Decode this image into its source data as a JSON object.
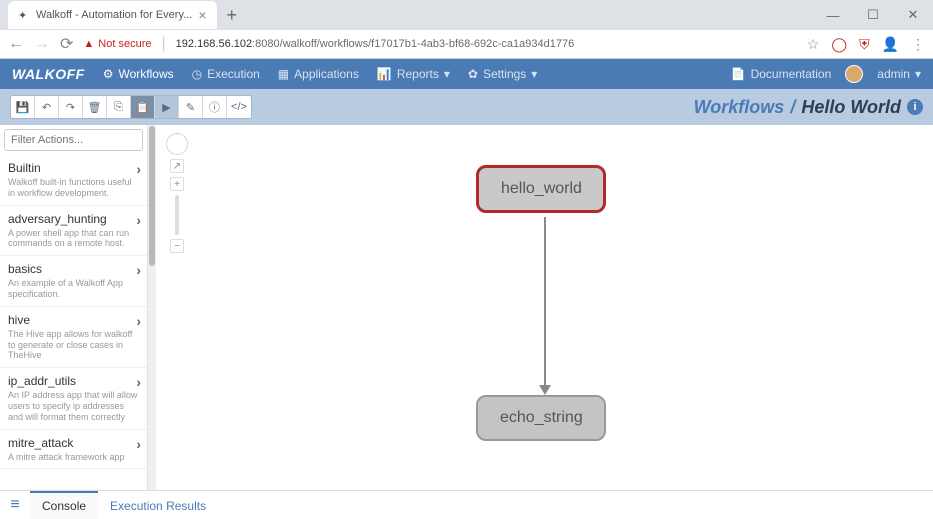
{
  "browser": {
    "tab_title": "Walkoff - Automation for Every...",
    "not_secure": "Not secure",
    "url_host": "192.168.56.102",
    "url_port": ":8080",
    "url_path": "/walkoff/workflows/f17017b1-4ab3-bf68-692c-ca1a934d1776"
  },
  "header": {
    "logo": "WALKOFF",
    "nav": {
      "workflows": "Workflows",
      "execution": "Execution",
      "applications": "Applications",
      "reports": "Reports",
      "settings": "Settings"
    },
    "docs": "Documentation",
    "user": "admin"
  },
  "breadcrumb": {
    "root": "Workflows",
    "sep": "/",
    "current": "Hello World"
  },
  "filter_placeholder": "Filter Actions...",
  "actions": [
    {
      "name": "Builtin",
      "desc": "Walkoff built-in functions useful in workflow development."
    },
    {
      "name": "adversary_hunting",
      "desc": "A power shell app that can run commands on a remote host."
    },
    {
      "name": "basics",
      "desc": "An example of a Walkoff App specification."
    },
    {
      "name": "hive",
      "desc": "The Hive app allows for walkoff to generate or close cases in TheHive"
    },
    {
      "name": "ip_addr_utils",
      "desc": "An IP address app that will allow users to specify ip addresses and will format them correctly"
    },
    {
      "name": "mitre_attack",
      "desc": "A mitre attack framework app"
    }
  ],
  "nodes": {
    "n1": "hello_world",
    "n2": "echo_string"
  },
  "bottom_tabs": {
    "console": "Console",
    "results": "Execution Results"
  }
}
